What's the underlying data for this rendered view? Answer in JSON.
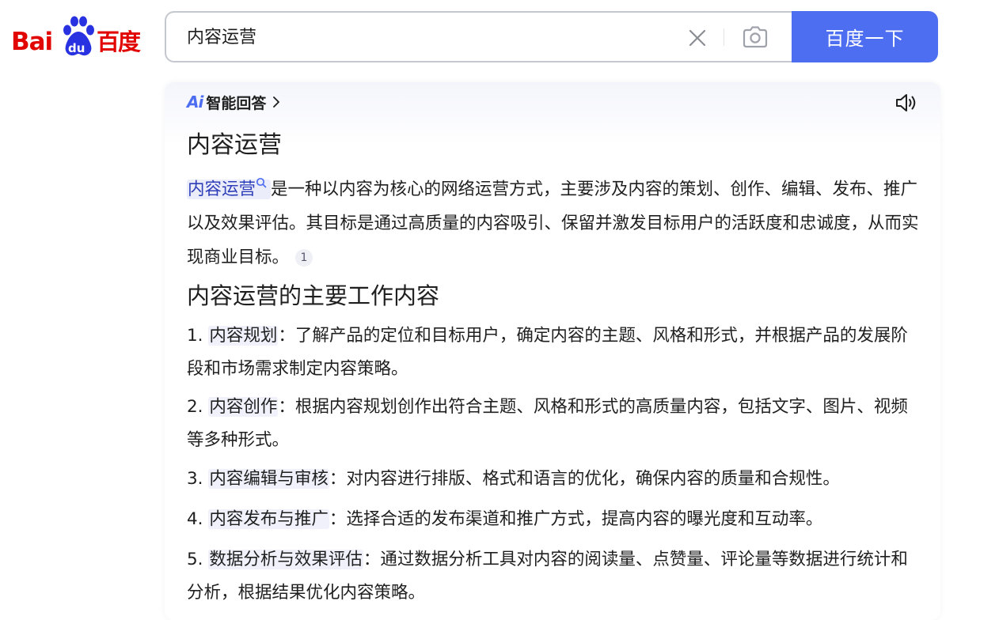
{
  "header": {
    "logo": {
      "bai": "Bai",
      "du": "du",
      "cn": "百度"
    },
    "search": {
      "value": "内容运营"
    },
    "search_button": "百度一下",
    "icons": {
      "clear": "close-icon",
      "camera": "camera-icon"
    }
  },
  "colors": {
    "accent": "#4e6ef2",
    "brand_red": "#e10601",
    "link": "#2d3eb8"
  },
  "answer": {
    "badge_logo": "Ai",
    "badge_title": "智能回答",
    "title": "内容运营",
    "intro": {
      "term": "内容运营",
      "text": "是一种以内容为核心的网络运营方式，主要涉及内容的策划、创作、编辑、发布、推广以及效果评估。其目标是通过高质量的内容吸引、保留并激发目标用户的活跃度和忠诚度，从而实现商业目标。",
      "citation": "1"
    },
    "section_title": "内容运营的主要工作内容",
    "items": [
      {
        "num": "1.",
        "term": "内容规划",
        "text": "：了解产品的定位和目标用户，确定内容的主题、风格和形式，并根据产品的发展阶段和市场需求制定内容策略。"
      },
      {
        "num": "2.",
        "term": "内容创作",
        "text": "：根据内容规划创作出符合主题、风格和形式的高质量内容，包括文字、图片、视频等多种形式。"
      },
      {
        "num": "3.",
        "term": "内容编辑与审核",
        "text": "：对内容进行排版、格式和语言的优化，确保内容的质量和合规性。"
      },
      {
        "num": "4.",
        "term": "内容发布与推广",
        "text": "：选择合适的发布渠道和推广方式，提高内容的曝光度和互动率。"
      },
      {
        "num": "5.",
        "term": "数据分析与效果评估",
        "text": "：通过数据分析工具对内容的阅读量、点赞量、评论量等数据进行统计和分析，根据结果优化内容策略。"
      }
    ]
  }
}
